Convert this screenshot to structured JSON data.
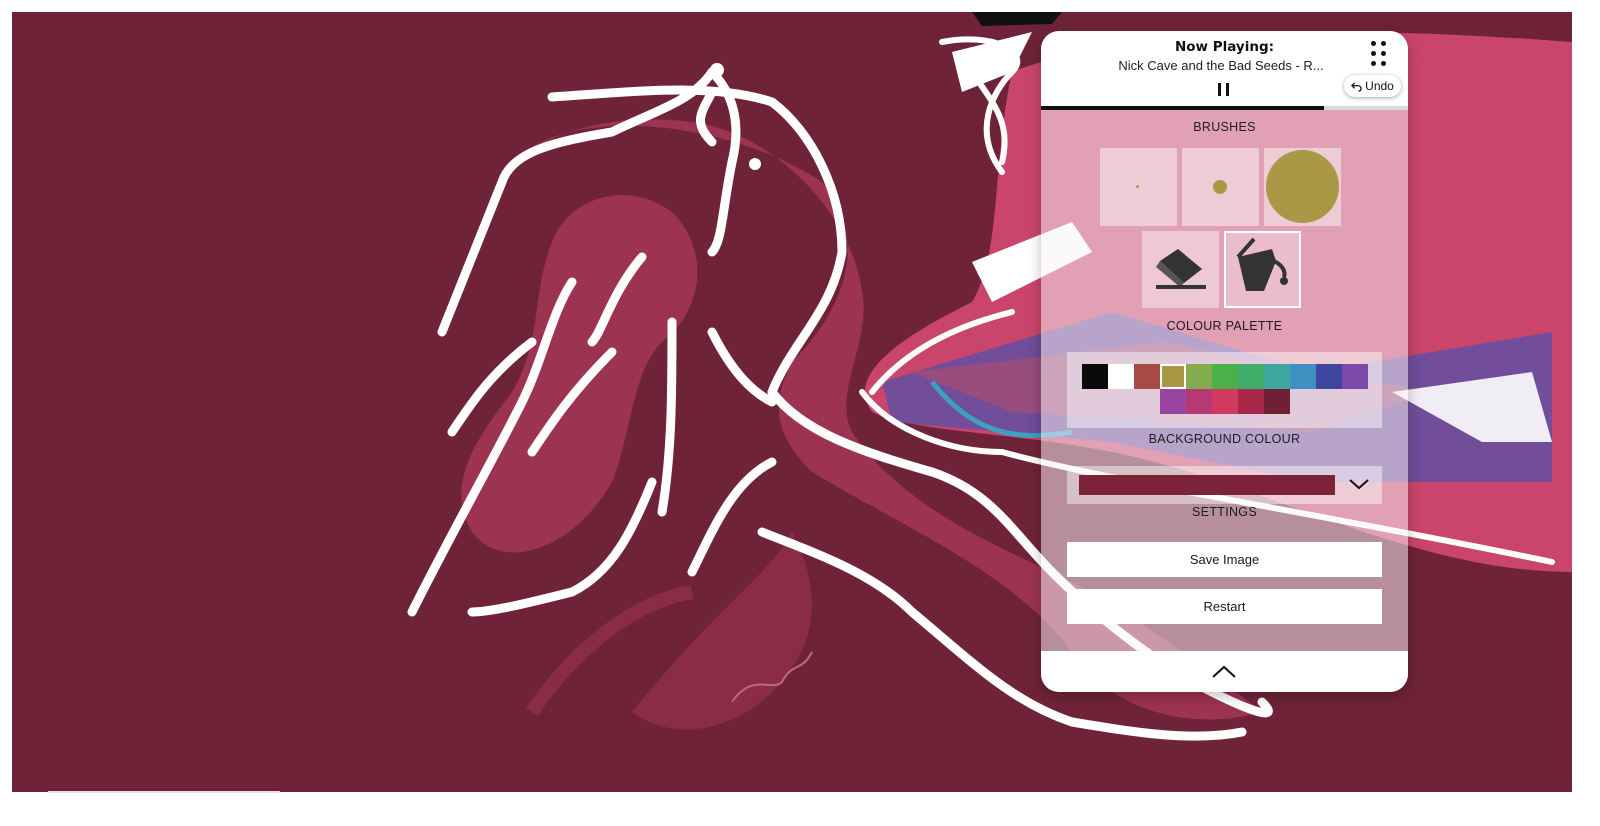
{
  "now_playing": {
    "title": "Now Playing:",
    "track": "Nick Cave and the Bad Seeds  - R...",
    "progress_fraction": 0.77
  },
  "controls": {
    "undo_label": "Undo",
    "pause_icon": "pause-icon",
    "menu_icon": "grid-dots-icon"
  },
  "sections": {
    "brushes": "BRUSHES",
    "palette": "COLOUR PALETTE",
    "background": "BACKGROUND COLOUR",
    "settings": "SETTINGS"
  },
  "brushes": [
    {
      "name": "small-brush",
      "size": "small"
    },
    {
      "name": "medium-brush",
      "size": "medium"
    },
    {
      "name": "large-brush",
      "size": "large",
      "selected": true
    }
  ],
  "tools": [
    {
      "name": "eraser-tool",
      "icon": "eraser-icon"
    },
    {
      "name": "paint-bucket-tool",
      "icon": "paint-bucket-icon",
      "selected": true
    }
  ],
  "palette": {
    "row1": [
      "#0a0a0a",
      "#ffffff",
      "#a94a47",
      "#a99845",
      "#82ac4d",
      "#4bb04c",
      "#3fad6a",
      "#3ca69f",
      "#4090c2",
      "#3e46a0",
      "#7e4aa9"
    ],
    "row2": [
      "#9a46a0",
      "#b53a73",
      "#cf3a5e",
      "#a8264a",
      "#6f1f36"
    ],
    "selected": "#a99845"
  },
  "background_colour": "#7c2339",
  "buttons": {
    "save": "Save Image",
    "restart": "Restart"
  },
  "colors": {
    "canvas": "#6f2338",
    "accent_brush": "#a99845"
  }
}
